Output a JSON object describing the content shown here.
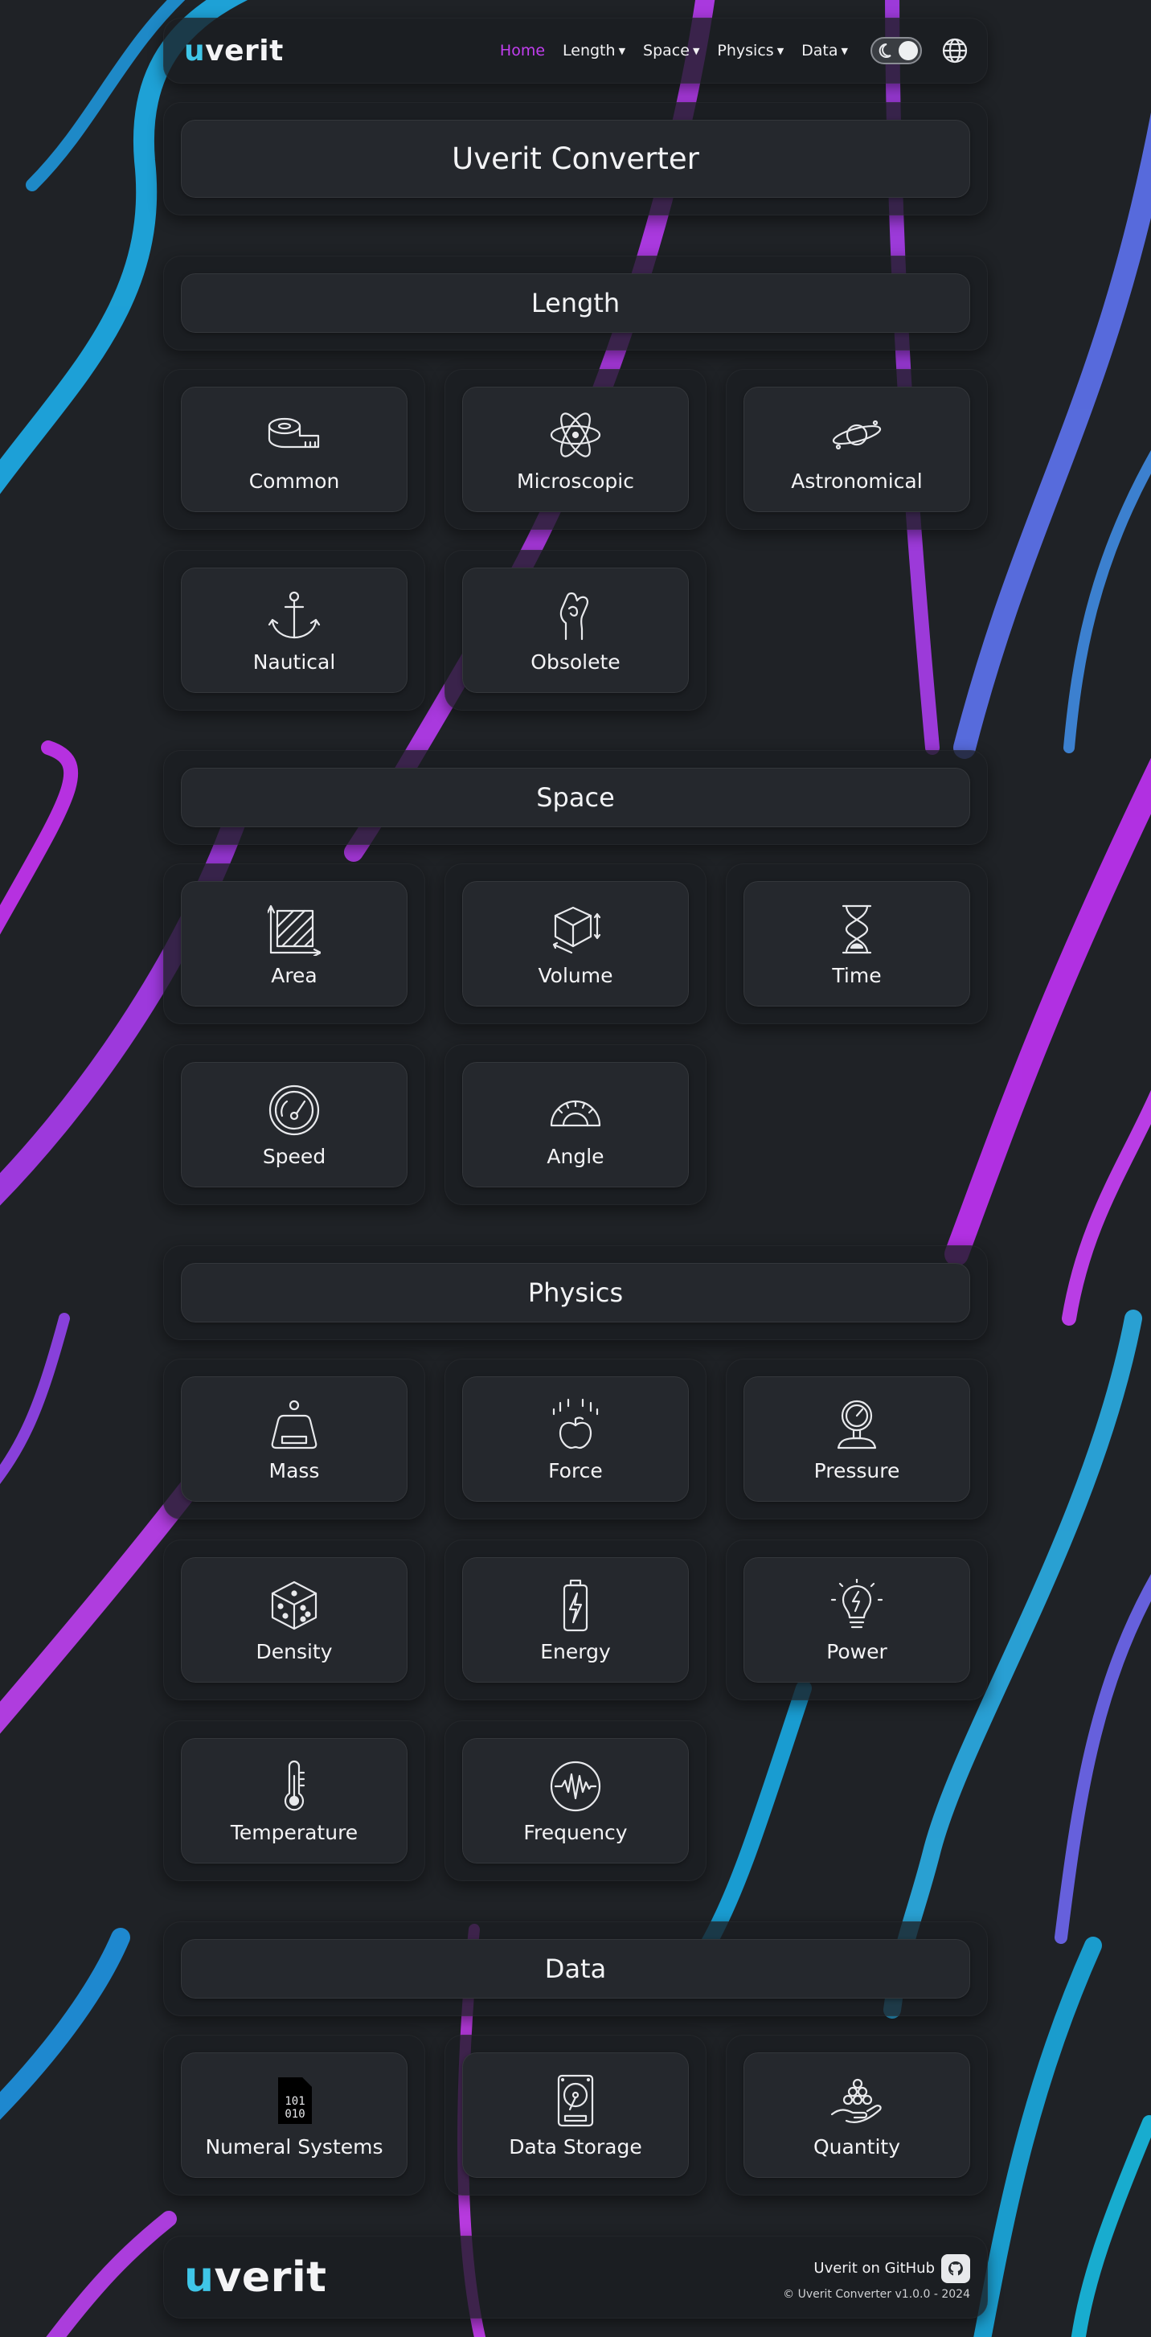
{
  "brand": {
    "logo_u": "u",
    "logo_rest": "verit"
  },
  "nav": {
    "home": "Home",
    "length": "Length",
    "space": "Space",
    "physics": "Physics",
    "data": "Data",
    "theme_toggle_icon": "moon-icon",
    "language_icon": "globe-icon"
  },
  "page_title": "Uverit Converter",
  "sections": [
    {
      "title": "Length",
      "items": [
        {
          "label": "Common",
          "icon": "tape-measure-icon"
        },
        {
          "label": "Microscopic",
          "icon": "atom-icon"
        },
        {
          "label": "Astronomical",
          "icon": "planet-icon"
        },
        {
          "label": "Nautical",
          "icon": "anchor-icon"
        },
        {
          "label": "Obsolete",
          "icon": "hand-icon"
        }
      ]
    },
    {
      "title": "Space",
      "items": [
        {
          "label": "Area",
          "icon": "area-icon"
        },
        {
          "label": "Volume",
          "icon": "cube-icon"
        },
        {
          "label": "Time",
          "icon": "hourglass-icon"
        },
        {
          "label": "Speed",
          "icon": "speedometer-icon"
        },
        {
          "label": "Angle",
          "icon": "protractor-icon"
        }
      ]
    },
    {
      "title": "Physics",
      "items": [
        {
          "label": "Mass",
          "icon": "weight-icon"
        },
        {
          "label": "Force",
          "icon": "apple-icon"
        },
        {
          "label": "Pressure",
          "icon": "pressure-gauge-icon"
        },
        {
          "label": "Density",
          "icon": "dice-icon"
        },
        {
          "label": "Energy",
          "icon": "battery-icon"
        },
        {
          "label": "Power",
          "icon": "lightbulb-icon"
        },
        {
          "label": "Temperature",
          "icon": "thermometer-icon"
        },
        {
          "label": "Frequency",
          "icon": "waveform-icon"
        }
      ]
    },
    {
      "title": "Data",
      "items": [
        {
          "label": "Numeral Systems",
          "icon": "binary-file-icon"
        },
        {
          "label": "Data Storage",
          "icon": "hard-drive-icon"
        },
        {
          "label": "Quantity",
          "icon": "hand-balls-icon"
        }
      ]
    }
  ],
  "footer": {
    "github": "Uverit on GitHub",
    "github_icon": "github-icon",
    "copyright": "© Uverit Converter v1.0.0 - 2024"
  },
  "colors": {
    "accent_pink": "#c23ff0",
    "accent_cyan": "#3fc6e8",
    "background": "#1f2226"
  }
}
